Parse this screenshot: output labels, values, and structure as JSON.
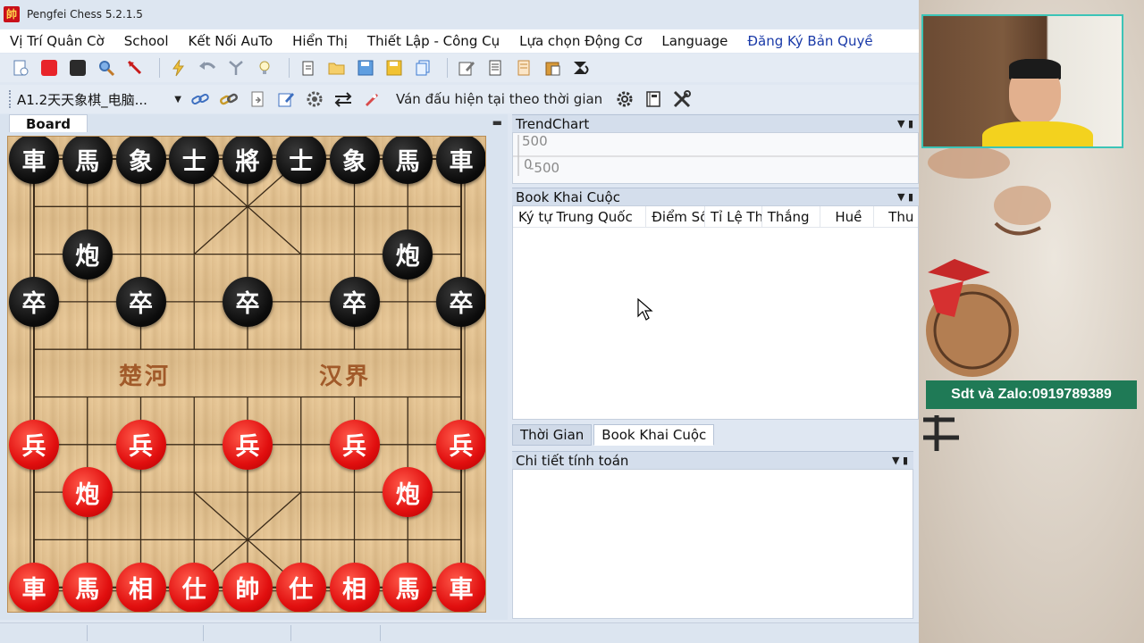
{
  "window": {
    "title": "Pengfei Chess 5.2.1.5",
    "icon_glyph": "帥"
  },
  "menu": [
    "Vị Trí Quân Cờ",
    "School",
    "Kết Nối AuTo",
    "Hiển Thị",
    "Thiết Lập - Công Cụ",
    "Lựa chọn Động Cơ",
    "Language",
    "Đăng Ký Bản Quyề"
  ],
  "toolbar2": {
    "engine": "A1.2天天象棋_电脑...",
    "time_mode": "Ván đấu hiện tại theo thời gian"
  },
  "board": {
    "tab_label": "Board",
    "river_left": "楚河",
    "river_right": "汉界",
    "pieces": [
      {
        "g": "車",
        "c": "black",
        "col": 0,
        "row": 0
      },
      {
        "g": "馬",
        "c": "black",
        "col": 1,
        "row": 0
      },
      {
        "g": "象",
        "c": "black",
        "col": 2,
        "row": 0
      },
      {
        "g": "士",
        "c": "black",
        "col": 3,
        "row": 0
      },
      {
        "g": "將",
        "c": "black",
        "col": 4,
        "row": 0
      },
      {
        "g": "士",
        "c": "black",
        "col": 5,
        "row": 0
      },
      {
        "g": "象",
        "c": "black",
        "col": 6,
        "row": 0
      },
      {
        "g": "馬",
        "c": "black",
        "col": 7,
        "row": 0
      },
      {
        "g": "車",
        "c": "black",
        "col": 8,
        "row": 0
      },
      {
        "g": "炮",
        "c": "black",
        "col": 1,
        "row": 2
      },
      {
        "g": "炮",
        "c": "black",
        "col": 7,
        "row": 2
      },
      {
        "g": "卒",
        "c": "black",
        "col": 0,
        "row": 3
      },
      {
        "g": "卒",
        "c": "black",
        "col": 2,
        "row": 3
      },
      {
        "g": "卒",
        "c": "black",
        "col": 4,
        "row": 3
      },
      {
        "g": "卒",
        "c": "black",
        "col": 6,
        "row": 3
      },
      {
        "g": "卒",
        "c": "black",
        "col": 8,
        "row": 3
      },
      {
        "g": "兵",
        "c": "red",
        "col": 0,
        "row": 6
      },
      {
        "g": "兵",
        "c": "red",
        "col": 2,
        "row": 6
      },
      {
        "g": "兵",
        "c": "red",
        "col": 4,
        "row": 6
      },
      {
        "g": "兵",
        "c": "red",
        "col": 6,
        "row": 6
      },
      {
        "g": "兵",
        "c": "red",
        "col": 8,
        "row": 6
      },
      {
        "g": "炮",
        "c": "red",
        "col": 1,
        "row": 7
      },
      {
        "g": "炮",
        "c": "red",
        "col": 7,
        "row": 7
      },
      {
        "g": "車",
        "c": "red",
        "col": 0,
        "row": 9
      },
      {
        "g": "馬",
        "c": "red",
        "col": 1,
        "row": 9
      },
      {
        "g": "相",
        "c": "red",
        "col": 2,
        "row": 9
      },
      {
        "g": "仕",
        "c": "red",
        "col": 3,
        "row": 9
      },
      {
        "g": "帥",
        "c": "red",
        "col": 4,
        "row": 9
      },
      {
        "g": "仕",
        "c": "red",
        "col": 5,
        "row": 9
      },
      {
        "g": "相",
        "c": "red",
        "col": 6,
        "row": 9
      },
      {
        "g": "馬",
        "c": "red",
        "col": 7,
        "row": 9
      },
      {
        "g": "車",
        "c": "red",
        "col": 8,
        "row": 9
      }
    ]
  },
  "trend": {
    "title": "TrendChart",
    "label_top": "500",
    "label_mid": "0",
    "label_bottom": "-500"
  },
  "book": {
    "title": "Book Khai Cuộc",
    "columns": [
      "Ký tự Trung Quốc",
      "Điểm Số",
      "Tỉ Lệ Th",
      "Thắng",
      "Huề",
      "Thu"
    ]
  },
  "tabs": [
    "Thời Gian",
    "Book Khai Cuộc"
  ],
  "calc": {
    "title": "Chi tiết tính toán"
  },
  "contact": "Sdt và Zalo:0919789389",
  "colors": {
    "accent_banner": "#1f7a56",
    "red_piece": "#e10f0f",
    "black_piece": "#0c0c0c"
  }
}
